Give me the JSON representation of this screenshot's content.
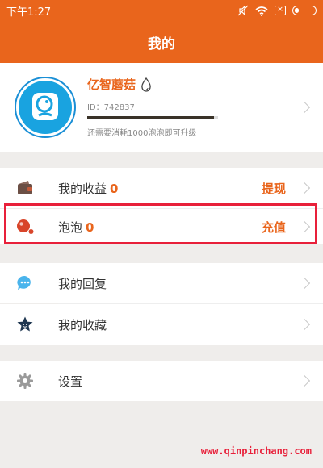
{
  "status_bar": {
    "time": "下午1:27",
    "icons": [
      "mute-icon",
      "wifi-icon",
      "sim-x-icon",
      "battery-icon"
    ]
  },
  "header": {
    "title": "我的"
  },
  "profile": {
    "name": "亿智蘑菇",
    "id_text": "ID：742837",
    "progress_fraction": 0.97,
    "upgrade_hint": "还需要消耗1000泡泡即可升级"
  },
  "menu": {
    "earnings": {
      "label": "我的收益",
      "count": "0",
      "action": "提现"
    },
    "bubbles": {
      "label": "泡泡",
      "count": "0",
      "action": "充值"
    },
    "replies": {
      "label": "我的回复"
    },
    "favorites": {
      "label": "我的收藏"
    },
    "settings": {
      "label": "设置"
    }
  },
  "watermark": "www.qinpinchang.com",
  "colors": {
    "accent": "#e9651c",
    "highlight": "#e8203a"
  }
}
